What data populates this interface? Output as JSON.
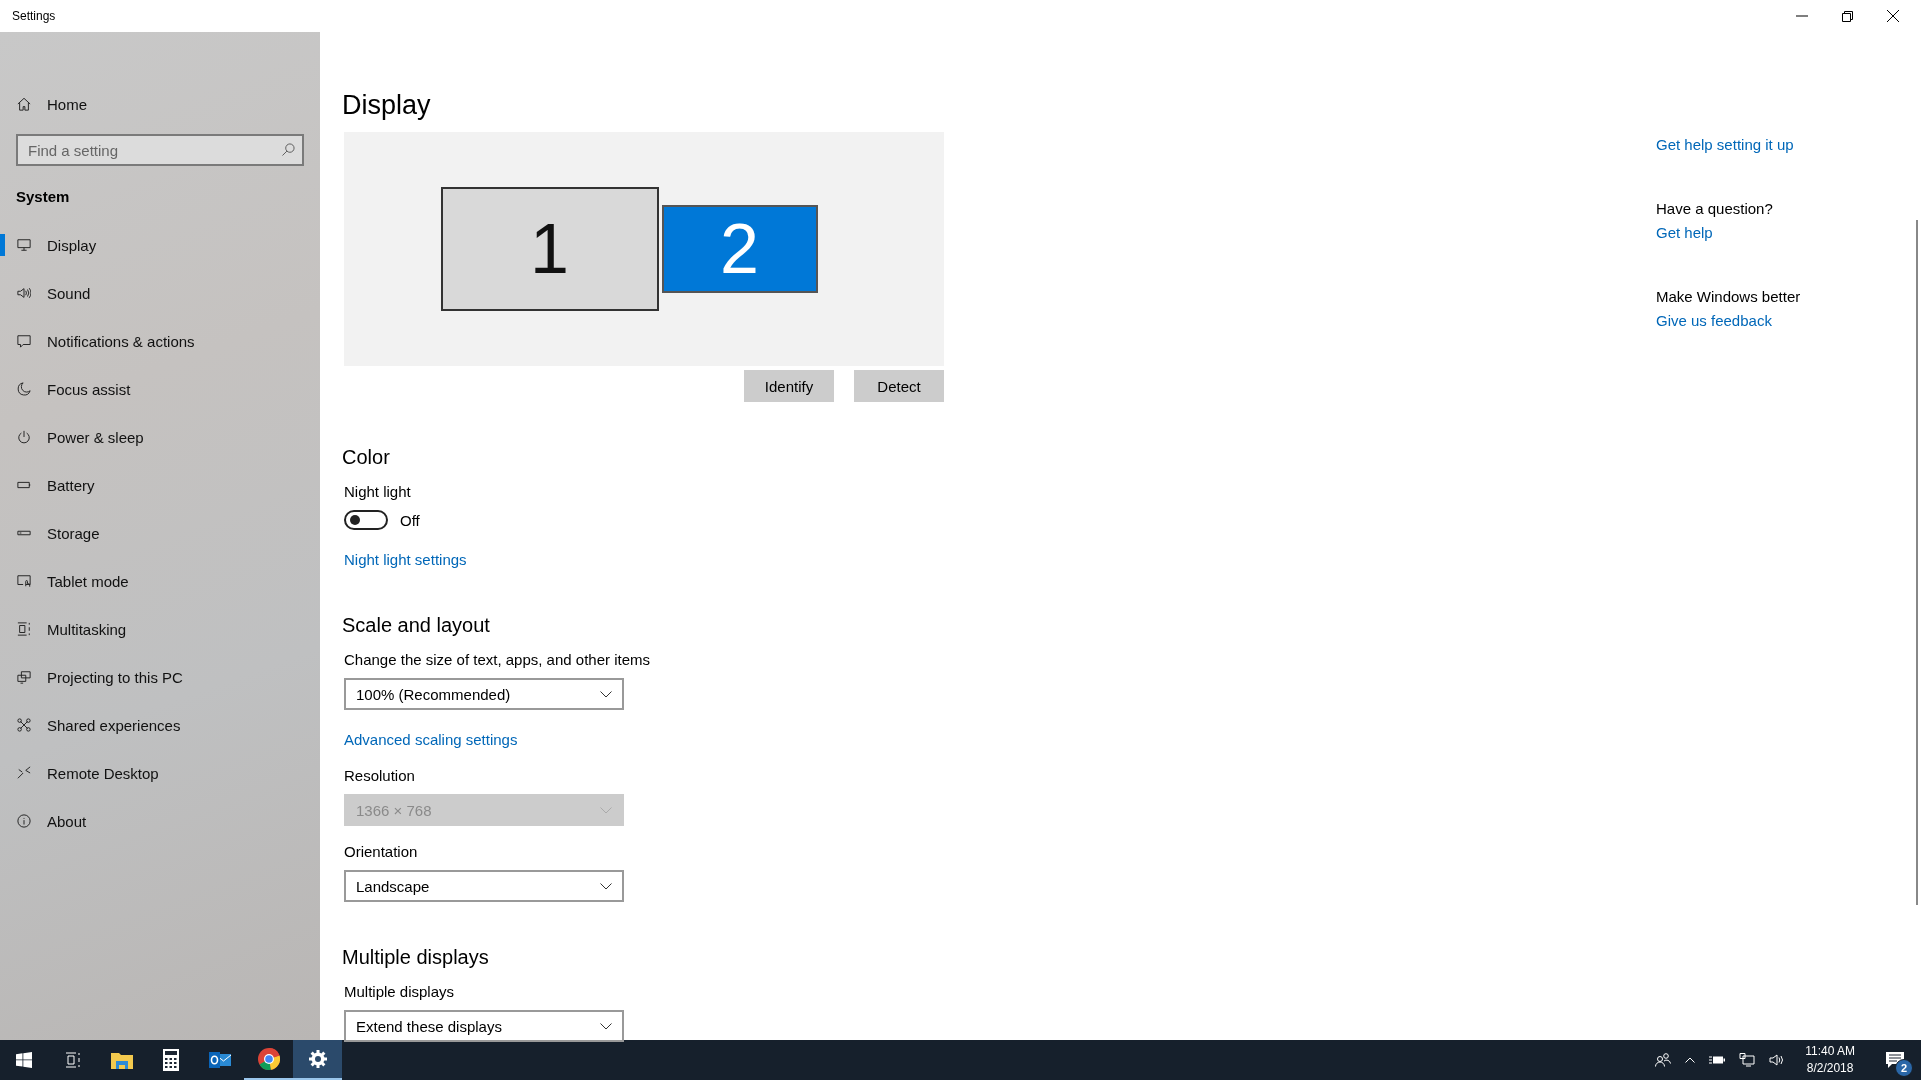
{
  "window": {
    "title": "Settings"
  },
  "sidebar": {
    "home": "Home",
    "search": {
      "placeholder": "Find a setting"
    },
    "section": "System",
    "items": [
      {
        "label": "Display",
        "selected": true
      },
      {
        "label": "Sound",
        "selected": false
      },
      {
        "label": "Notifications & actions",
        "selected": false
      },
      {
        "label": "Focus assist",
        "selected": false
      },
      {
        "label": "Power & sleep",
        "selected": false
      },
      {
        "label": "Battery",
        "selected": false
      },
      {
        "label": "Storage",
        "selected": false
      },
      {
        "label": "Tablet mode",
        "selected": false
      },
      {
        "label": "Multitasking",
        "selected": false
      },
      {
        "label": "Projecting to this PC",
        "selected": false
      },
      {
        "label": "Shared experiences",
        "selected": false
      },
      {
        "label": "Remote Desktop",
        "selected": false
      },
      {
        "label": "About",
        "selected": false
      }
    ]
  },
  "page": {
    "title": "Display",
    "monitors": [
      {
        "label": "1",
        "selected": false
      },
      {
        "label": "2",
        "selected": true
      }
    ],
    "buttons": [
      "Identify",
      "Detect"
    ],
    "sections": [
      {
        "heading": "Color",
        "items": [
          {
            "kind": "label",
            "text": "Night light"
          },
          {
            "kind": "toggle",
            "on": false,
            "text": "Off"
          },
          {
            "kind": "link",
            "text": "Night light settings"
          }
        ]
      },
      {
        "heading": "Scale and layout",
        "items": [
          {
            "kind": "label",
            "text": "Change the size of text, apps, and other items"
          },
          {
            "kind": "dropdown",
            "value": "100% (Recommended)",
            "disabled": false
          },
          {
            "kind": "link",
            "text": "Advanced scaling settings"
          },
          {
            "kind": "label",
            "text": "Resolution"
          },
          {
            "kind": "dropdown",
            "value": "1366 × 768",
            "disabled": true
          },
          {
            "kind": "label",
            "text": "Orientation"
          },
          {
            "kind": "dropdown",
            "value": "Landscape",
            "disabled": false
          }
        ]
      },
      {
        "heading": "Multiple displays",
        "items": [
          {
            "kind": "label",
            "text": "Multiple displays"
          },
          {
            "kind": "dropdown",
            "value": "Extend these displays",
            "disabled": false
          }
        ]
      }
    ]
  },
  "related": [
    {
      "kind": "link",
      "text": "Get help setting it up"
    },
    {
      "kind": "heading",
      "text": "Have a question?"
    },
    {
      "kind": "link",
      "text": "Get help"
    },
    {
      "kind": "heading",
      "text": "Make Windows better"
    },
    {
      "kind": "link",
      "text": "Give us feedback"
    }
  ],
  "taskbar": {
    "apps": [
      {
        "running": false,
        "selected": false
      },
      {
        "running": false,
        "selected": false
      },
      {
        "running": false,
        "selected": false
      },
      {
        "running": false,
        "selected": false
      },
      {
        "running": true,
        "selected": false
      },
      {
        "running": true,
        "selected": true
      }
    ],
    "time": "11:40 AM",
    "date": "8/2/2018",
    "notifications": "2"
  }
}
